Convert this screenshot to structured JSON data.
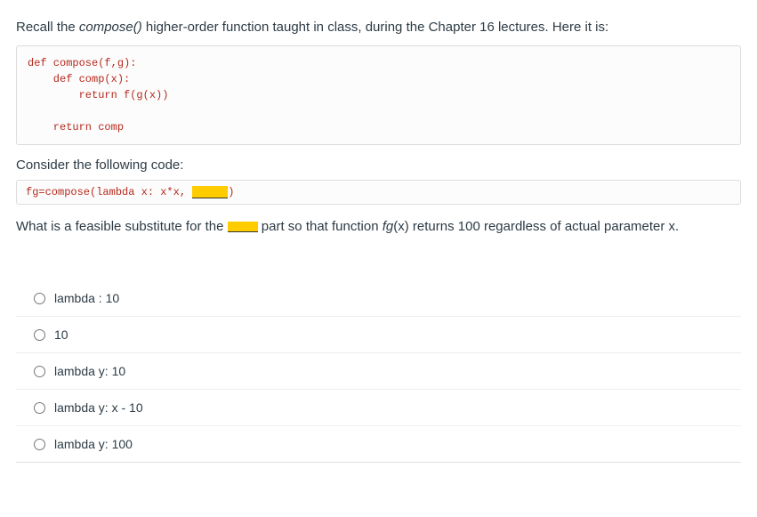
{
  "intro": {
    "prefix": "Recall the ",
    "func": "compose()",
    "suffix": " higher-order function taught in class, during the Chapter 16 lectures. Here it is:"
  },
  "code_block": "def compose(f,g):\n    def comp(x):\n        return f(g(x))\n\n    return comp",
  "consider": "Consider the following code:",
  "code_inline_before": "fg=compose(lambda x: x*x, ",
  "code_inline_after": ")",
  "question": {
    "before": "What is a feasible substitute for the ",
    "mid": " part so that function ",
    "fg": "fg",
    "paren": "(x)",
    "after": " returns 100 regardless of actual parameter x."
  },
  "options": [
    "lambda : 10",
    "10",
    "lambda y: 10",
    "lambda y: x - 10",
    "lambda y: 100"
  ]
}
